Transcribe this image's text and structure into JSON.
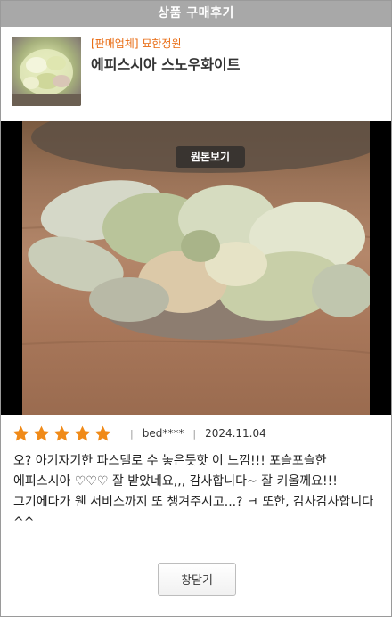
{
  "header": {
    "title": "상품 구매후기"
  },
  "product": {
    "seller": "[판매업체] 묘한정원",
    "name": "에피스시아 스노우화이트"
  },
  "photo": {
    "original_button": "원본보기"
  },
  "review": {
    "rating": 5,
    "rating_max": 5,
    "author": "bed****",
    "date": "2024.11.04",
    "text": "오? 아기자기한 파스텔로 수 놓은듯핫 이 느낌!!! 포슬포슬한 에피스시아 ♡♡♡ 잘 받았네요,,, 감사합니다~ 잘 키울께요!!! 그기에다가 웬 서비스까지 또 챙겨주시고...? ㅋ 또한, 감사감사합니다^^"
  },
  "footer": {
    "close_label": "창닫기"
  },
  "colors": {
    "header_bg": "#a8a8a8",
    "seller": "#e86a10",
    "star": "#f08a18"
  }
}
